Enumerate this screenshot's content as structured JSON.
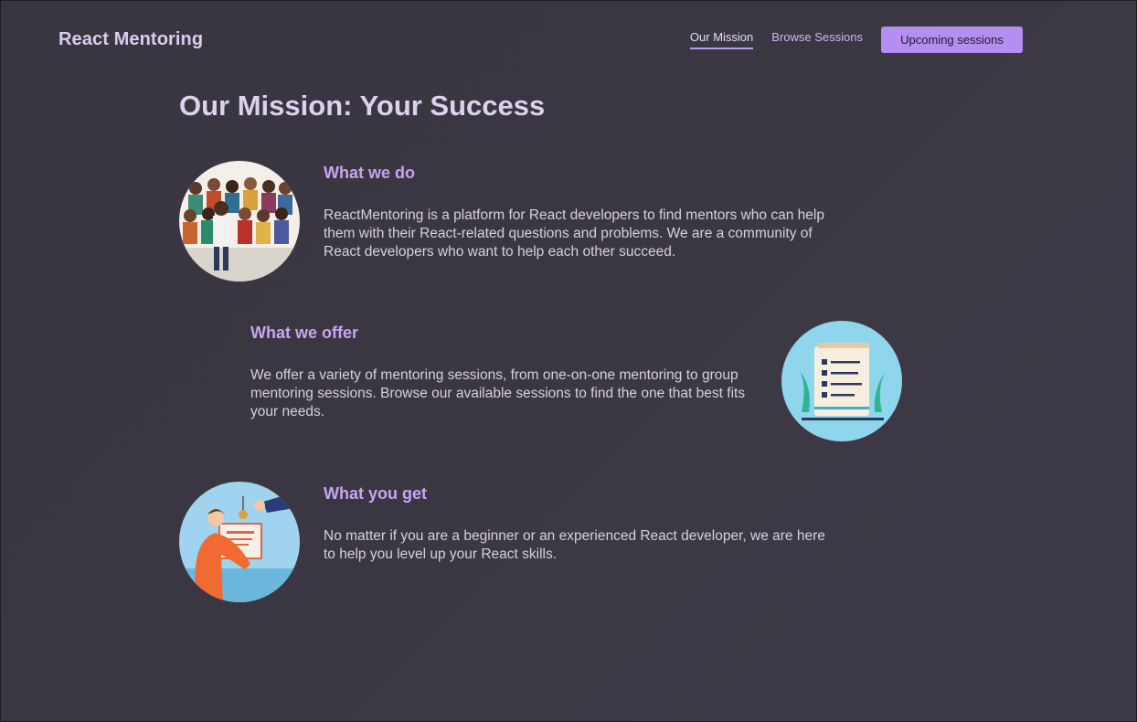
{
  "header": {
    "brand": "React Mentoring",
    "nav": {
      "our_mission": "Our Mission",
      "browse_sessions": "Browse Sessions",
      "upcoming_sessions": "Upcoming sessions"
    }
  },
  "main": {
    "title": "Our Mission: Your Success",
    "sections": [
      {
        "heading": "What we do",
        "body": "ReactMentoring is a platform for React developers to find mentors who can help them with their React-related questions and problems. We are a community of React developers who want to help each other succeed.",
        "image": "community-illustration"
      },
      {
        "heading": "What we offer",
        "body": "We offer a variety of mentoring sessions, from one-on-one mentoring to group mentoring sessions. Browse our available sessions to find the one that best fits your needs.",
        "image": "checklist-illustration"
      },
      {
        "heading": "What you get",
        "body": "No matter if you are a beginner or an experienced React developer, we are here to help you level up your React skills.",
        "image": "certificate-illustration"
      }
    ]
  },
  "colors": {
    "background": "#3b3742",
    "accent": "#b48ef0",
    "heading": "#c7a5f2"
  }
}
